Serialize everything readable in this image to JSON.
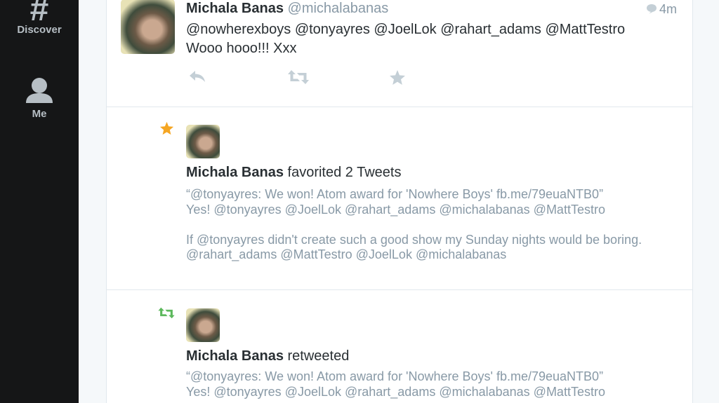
{
  "sidebar": {
    "items": [
      {
        "label": "Discover",
        "icon": "hashtag-icon"
      },
      {
        "label": "Me",
        "icon": "person-icon"
      }
    ]
  },
  "tweet": {
    "author_name": "Michala Banas",
    "author_handle": "@michalabanas",
    "time": "4m",
    "text": "@nowherexboys @tonyayres @JoelLok @rahart_adams @MattTestro\nWooo hooo!!! Xxx",
    "actions": [
      "reply-icon",
      "retweet-icon",
      "favorite-icon"
    ]
  },
  "activities": [
    {
      "type": "favorite",
      "icon": "star-icon",
      "actor": "Michala Banas",
      "action": "favorited 2 Tweets",
      "quotes": [
        "“@tonyayres: We won! Atom award for 'Nowhere Boys' fb.me/79euaNTB0”\nYes! @tonyayres @JoelLok @rahart_adams @michalabanas @MattTestro",
        "If @tonyayres didn't create such a good show my Sunday nights would be boring.\n@rahart_adams @MattTestro @JoelLok @michalabanas"
      ]
    },
    {
      "type": "retweet",
      "icon": "retweet-icon",
      "actor": "Michala Banas",
      "action": "retweeted",
      "quotes": [
        "“@tonyayres: We won! Atom award for 'Nowhere Boys' fb.me/79euaNTB0”\nYes! @tonyayres @JoelLok @rahart_adams @michalabanas @MattTestro"
      ]
    }
  ],
  "colors": {
    "sidebar_bg": "#151617",
    "favorite_star": "#f5a623",
    "retweet_green": "#5cb85c",
    "muted_text": "#8899a6",
    "action_icon": "#c4cfd6"
  }
}
